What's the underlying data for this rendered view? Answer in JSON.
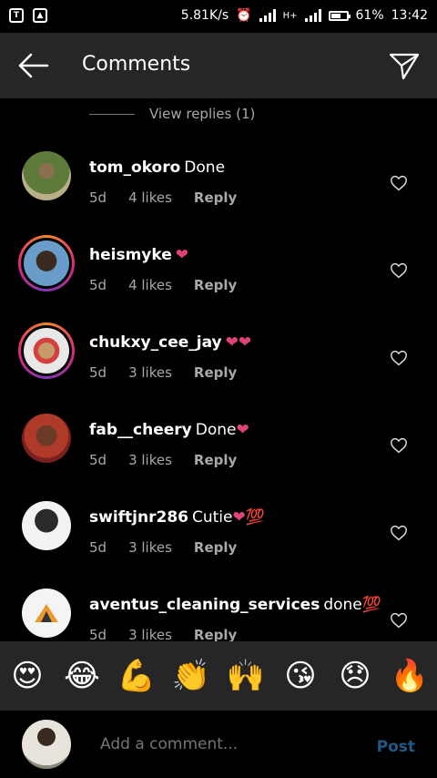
{
  "status": {
    "speed": "5.81K/s",
    "network": "H+",
    "battery_pct": "61%",
    "battery_level": 0.61,
    "time": "13:42"
  },
  "header": {
    "title": "Comments"
  },
  "view_replies": "View replies (1)",
  "comments": [
    {
      "user": "tom_okoro",
      "body": "Done",
      "emoji": "",
      "time": "5d",
      "likes": "4 likes",
      "reply": "Reply",
      "ring": false
    },
    {
      "user": "heismyke",
      "body": "",
      "emoji": "❤",
      "time": "5d",
      "likes": "4 likes",
      "reply": "Reply",
      "ring": true
    },
    {
      "user": "chukxy_cee_jay",
      "body": "",
      "emoji": "❤❤",
      "time": "5d",
      "likes": "3 likes",
      "reply": "Reply",
      "ring": true
    },
    {
      "user": "fab__cheery",
      "body": "Done",
      "emoji": "❤",
      "time": "5d",
      "likes": "3 likes",
      "reply": "Reply",
      "ring": false
    },
    {
      "user": "swiftjnr286",
      "body": "Cutie",
      "emoji": "❤💯",
      "time": "5d",
      "likes": "3 likes",
      "reply": "Reply",
      "ring": false
    },
    {
      "user": "aventus_cleaning_services",
      "body": "done",
      "emoji": "💯",
      "time": "5d",
      "likes": "3 likes",
      "reply": "Reply",
      "ring": false
    }
  ],
  "emoji_bar": [
    "😍",
    "😂",
    "💪",
    "👏",
    "🙌",
    "😘",
    "😞",
    "🔥"
  ],
  "compose": {
    "placeholder": "Add a comment...",
    "post_label": "Post"
  }
}
